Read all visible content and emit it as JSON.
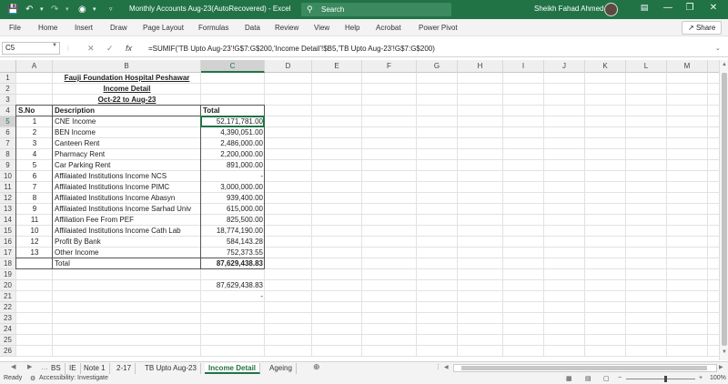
{
  "titlebar": {
    "doc_title": "Monthly Accounts Aug-23(AutoRecovered)  -  Excel",
    "search_label": "Search",
    "user_name": "Sheikh Fahad Ahmed",
    "save_icon": "save-icon",
    "undo_icon": "undo-icon",
    "redo_icon": "redo-icon"
  },
  "menu": {
    "items": [
      "File",
      "Home",
      "Insert",
      "Draw",
      "Page Layout",
      "Formulas",
      "Data",
      "Review",
      "View",
      "Help",
      "Acrobat",
      "Power Pivot"
    ],
    "share_label": "Share"
  },
  "formula_bar": {
    "name_box": "C5",
    "cancel": "✕",
    "enter": "✓",
    "fx": "fx",
    "formula": "=SUMIF('TB Upto Aug-23'!G$7:G$200,'Income Detail'!$B5,'TB Upto Aug-23'!G$7:G$200)"
  },
  "columns": [
    "A",
    "B",
    "C",
    "D",
    "E",
    "F",
    "G",
    "H",
    "I",
    "J",
    "K",
    "L",
    "M",
    "N"
  ],
  "rows": [
    "1",
    "2",
    "3",
    "4",
    "5",
    "6",
    "7",
    "8",
    "9",
    "10",
    "11",
    "12",
    "13",
    "14",
    "15",
    "16",
    "17",
    "18",
    "19",
    "20",
    "21",
    "22",
    "23",
    "24",
    "25",
    "26"
  ],
  "sheet": {
    "title1": "Fauji Foundation Hospital Peshawar",
    "title2": "Income Detail",
    "title3": "Oct-22 to Aug-23",
    "hdr_sno": "S.No",
    "hdr_desc": "Description",
    "hdr_total": "Total",
    "items": [
      {
        "sno": "1",
        "desc": "CNE Income",
        "total": "52,171,781.00"
      },
      {
        "sno": "2",
        "desc": "BEN Income",
        "total": "4,390,051.00"
      },
      {
        "sno": "3",
        "desc": "Canteen Rent",
        "total": "2,486,000.00"
      },
      {
        "sno": "4",
        "desc": "Pharmacy Rent",
        "total": "2,200,000.00"
      },
      {
        "sno": "5",
        "desc": "Car Parking Rent",
        "total": "891,000.00"
      },
      {
        "sno": "6",
        "desc": "Affilaiated Institutions Income NCS",
        "total": "-"
      },
      {
        "sno": "7",
        "desc": "Affilaiated Institutions Income PIMC",
        "total": "3,000,000.00"
      },
      {
        "sno": "8",
        "desc": "Affilaiated Institutions Income Abasyn",
        "total": "939,400.00"
      },
      {
        "sno": "9",
        "desc": "Affilaiated Institutions Income Sarhad Univ",
        "total": "615,000.00"
      },
      {
        "sno": "11",
        "desc": "Affiliation Fee From PEF",
        "total": "825,500.00"
      },
      {
        "sno": "10",
        "desc": "Affilaiated Institutions Income Cath Lab",
        "total": "18,774,190.00"
      },
      {
        "sno": "12",
        "desc": "Profit By Bank",
        "total": "584,143.28"
      },
      {
        "sno": "13",
        "desc": "Other Income",
        "total": "752,373.55"
      }
    ],
    "total_label": "Total",
    "total_value": "87,629,438.83",
    "c20": "87,629,438.83",
    "c21": "-"
  },
  "tabs": [
    "BS",
    "IE",
    "Note 1",
    "2-17",
    "TB Upto Aug-23",
    "Income Detail",
    "Ageing"
  ],
  "active_tab": "Income Detail",
  "status": {
    "ready": "Ready",
    "accessibility": "Accessibility: Investigate",
    "zoom": "100%"
  }
}
